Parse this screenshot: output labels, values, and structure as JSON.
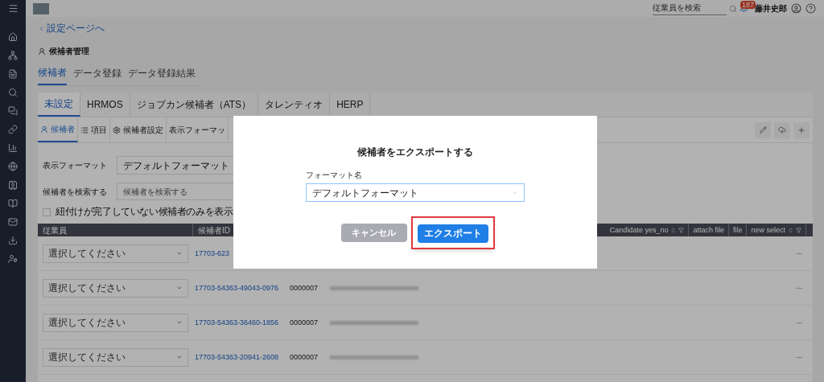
{
  "header": {
    "search_placeholder": "従業員を検索",
    "notification_count": "187",
    "user_name": "藤井史郎"
  },
  "back_link": "設定ページへ",
  "page_title": "候補者管理",
  "tabs": [
    {
      "label": "候補者",
      "selected": true
    },
    {
      "label": "データ登録",
      "selected": false
    },
    {
      "label": "データ登録結果",
      "selected": false
    }
  ],
  "source_tabs": [
    {
      "label": "未設定",
      "selected": true
    },
    {
      "label": "HRMOS",
      "selected": false
    },
    {
      "label": "ジョブカン候補者（ATS）",
      "selected": false
    },
    {
      "label": "タレンティオ",
      "selected": false
    },
    {
      "label": "HERP",
      "selected": false
    }
  ],
  "sub_tabs": [
    {
      "label": "候補者",
      "kind": "person",
      "selected": true
    },
    {
      "label": "項目",
      "kind": "list",
      "selected": false
    },
    {
      "label": "候補者設定",
      "kind": "gear",
      "selected": false
    },
    {
      "label": "表示フォーマッ",
      "kind": "none",
      "selected": false
    }
  ],
  "filters": {
    "format_label": "表示フォーマット",
    "format_value": "デフォルトフォーマット",
    "search_label": "候補者を検索する",
    "search_placeholder": "候補者を検索する",
    "checkbox_label": "紐付けが完了していない候補者のみを表示",
    "checkbox_checked": false
  },
  "table": {
    "left_columns": [
      "従業員",
      "候補者ID"
    ],
    "right_columns": [
      {
        "label": "Candidate yes_no",
        "sortable": true
      },
      {
        "label": "attach file",
        "sortable": false
      },
      {
        "label": "file",
        "sortable": false
      },
      {
        "label": "new select",
        "sortable": true
      }
    ],
    "rows": [
      {
        "employee_placeholder": "選択してください",
        "candidate_id": "17703-623"
      },
      {
        "employee_placeholder": "選択してください",
        "candidate_id": "17703-54363-49043-0976",
        "number": "0000007"
      },
      {
        "employee_placeholder": "選択してください",
        "candidate_id": "17703-54363-36460-1856",
        "number": "0000007"
      },
      {
        "employee_placeholder": "選択してください",
        "candidate_id": "17703-54363-20941-2608",
        "number": "0000007"
      }
    ]
  },
  "modal": {
    "title": "候補者をエクスポートする",
    "field_label": "フォーマット名",
    "field_value": "デフォルトフォーマット",
    "cancel_label": "キャンセル",
    "export_label": "エクスポート",
    "export_highlighted": true
  }
}
